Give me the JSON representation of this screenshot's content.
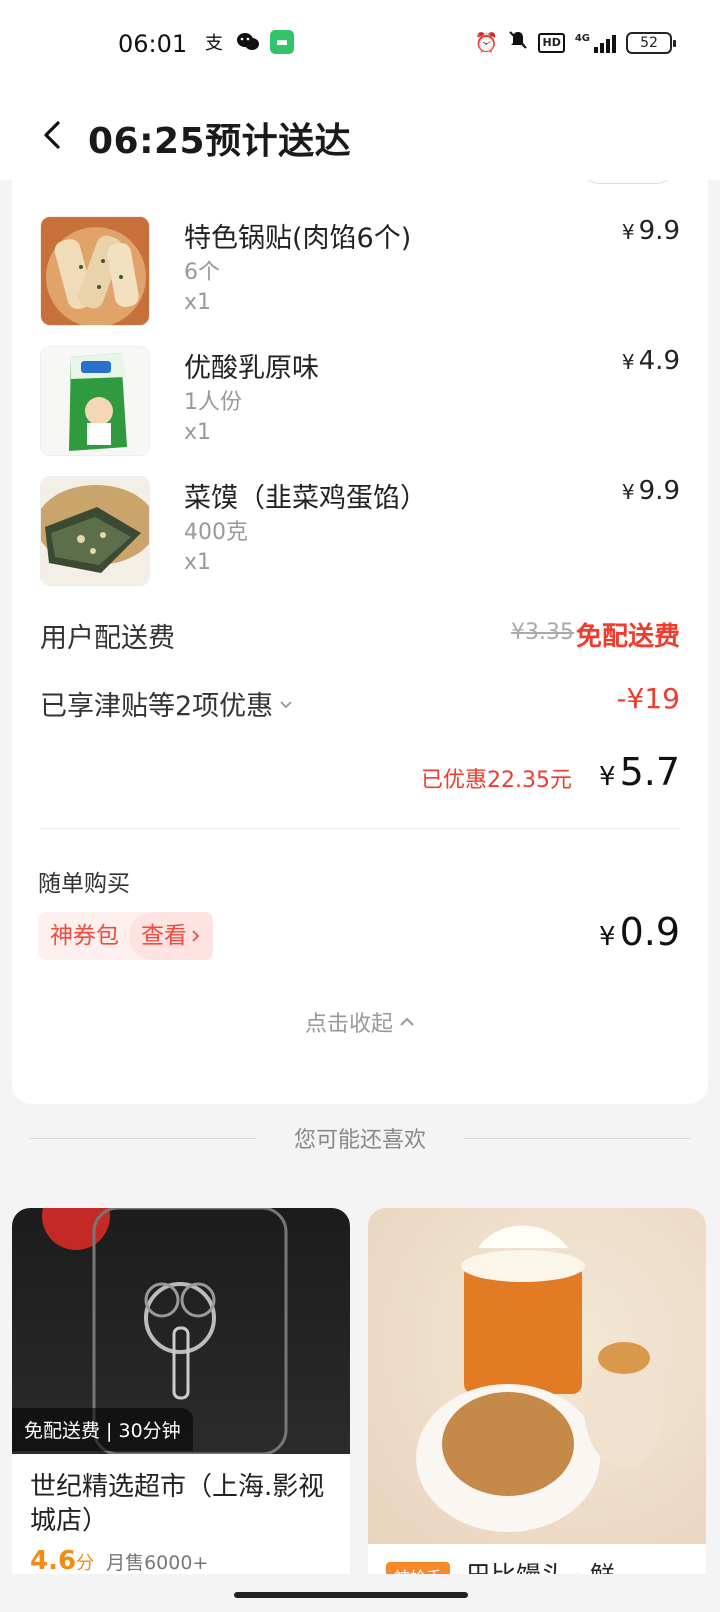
{
  "status_bar": {
    "time": "06:01",
    "battery": "52",
    "network": "4G"
  },
  "header": {
    "title": "06:25预计送达"
  },
  "order": {
    "items": [
      {
        "name": "特色锅贴(肉馅6个)",
        "spec": "6个",
        "qty": "x1",
        "price": "9.9"
      },
      {
        "name": "优酸乳原味",
        "spec": "1人份",
        "qty": "x1",
        "price": "4.9"
      },
      {
        "name": "菜馍（韭菜鸡蛋馅）",
        "spec": "400克",
        "qty": "x1",
        "price": "9.9"
      }
    ],
    "currency": "¥",
    "delivery_fee_label": "用户配送费",
    "delivery_fee_original": "¥3.35",
    "delivery_fee_value": "免配送费",
    "discount_label": "已享津贴等2项优惠",
    "discount_value": "-¥19",
    "saved_text": "已优惠22.35元",
    "total": "5.7",
    "addon_title": "随单购买",
    "coupon_label": "神券包",
    "coupon_action": "查看",
    "coupon_price": "0.9",
    "collapse_label": "点击收起"
  },
  "recommend": {
    "title": "您可能还喜欢",
    "cards": [
      {
        "badge": "免配送费 | 30分钟",
        "name": "世纪精选超市（上海.影视城店）",
        "rating": "4.6",
        "rating_unit": "分",
        "sales": "月售6000+"
      },
      {
        "tag": "神抢手",
        "name": "巴比馒头 · 鲜"
      }
    ]
  },
  "colors": {
    "accent_red": "#f03c2c",
    "rating_orange": "#f58b12"
  }
}
